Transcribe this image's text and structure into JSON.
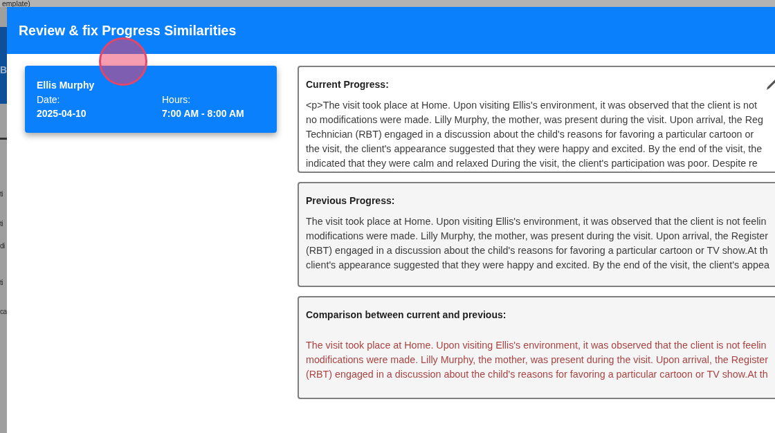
{
  "background_page": {
    "title_fragment": "emplate)",
    "header_letter": "B",
    "side_fragments": [
      "ti",
      "ti",
      "di",
      "ti",
      "ca"
    ]
  },
  "dialog": {
    "title": "Review & fix Progress Similarities"
  },
  "session_card": {
    "client_name": "Ellis Murphy",
    "fields": [
      {
        "label": "Date:",
        "value": "2025-04-10"
      },
      {
        "label": "Hours:",
        "value": "7:00 AM - 8:00 AM"
      }
    ]
  },
  "panels": [
    {
      "kind": "current",
      "title": "Current Progress:",
      "editable": true,
      "lines": [
        "<p>The visit took place at Home. Upon visiting Ellis's environment, it was observed that the client is not",
        "no modifications were made. Lilly Murphy, the mother, was present during the visit. Upon arrival, the Reg",
        "Technician (RBT) engaged in a discussion about the child's reasons for favoring a particular cartoon or",
        "the visit, the client's appearance suggested that they were happy and excited. By the end of the visit, the",
        "indicated that they were calm and relaxed During the visit, the client's participation was poor. Despite re"
      ]
    },
    {
      "kind": "previous",
      "title": "Previous Progress:",
      "editable": false,
      "lines": [
        "The visit took place at Home. Upon visiting Ellis's environment, it was observed that the client is not feelin",
        "modifications were made. Lilly Murphy, the mother, was present during the visit. Upon arrival, the Register",
        "(RBT) engaged in a discussion about the child's reasons for favoring a particular cartoon or TV show.At th",
        "client's appearance suggested that they were happy and excited. By the end of the visit, the client's appea"
      ]
    },
    {
      "kind": "comparison",
      "title": "Comparison between current and previous:",
      "editable": false,
      "lines": [
        "The visit took place at Home. Upon visiting Ellis's environment, it was observed that the client is not feelin",
        "modifications were made. Lilly Murphy, the mother, was present during the visit. Upon arrival, the Register",
        "(RBT) engaged in a discussion about the child's reasons for favoring a particular cartoon or TV show.At th"
      ]
    }
  ]
}
